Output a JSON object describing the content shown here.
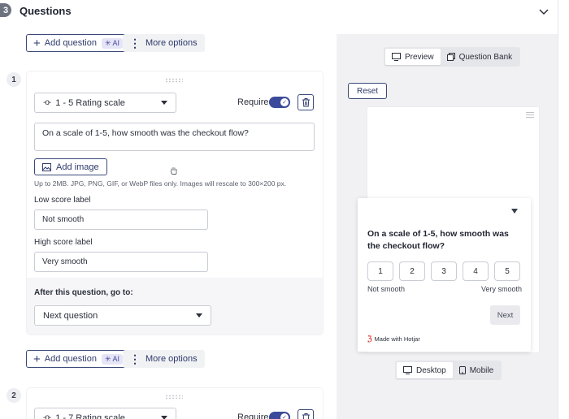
{
  "section": {
    "step": "3",
    "title": "Questions"
  },
  "actions": {
    "add_question": "Add question",
    "ai": "AI",
    "more_options": "More options"
  },
  "question1": {
    "number": "1",
    "type": "1 - 5 Rating scale",
    "required_label": "Required",
    "required": true,
    "text": "On a scale of 1-5, how smooth was the checkout flow?",
    "add_image": "Add image",
    "image_hint": "Up to 2MB. JPG, PNG, GIF, or WebP files only. Images will rescale to 300×200 px.",
    "low_label": "Low score label",
    "low_value": "Not smooth",
    "high_label": "High score label",
    "high_value": "Very smooth",
    "after_label": "After this question, go to:",
    "after_value": "Next question"
  },
  "question2": {
    "number": "2",
    "type": "1 - 7 Rating scale",
    "required_label": "Required"
  },
  "preview": {
    "tab_preview": "Preview",
    "tab_bank": "Question Bank",
    "reset": "Reset",
    "question": "On a scale of 1-5, how smooth was the checkout flow?",
    "ratings": [
      "1",
      "2",
      "3",
      "4",
      "5"
    ],
    "low": "Not smooth",
    "high": "Very smooth",
    "next": "Next",
    "brand": "Made with Hotjar",
    "device_desktop": "Desktop",
    "device_mobile": "Mobile"
  },
  "colors": {
    "accent": "#3b4a9a",
    "brand": "#e0443e"
  }
}
